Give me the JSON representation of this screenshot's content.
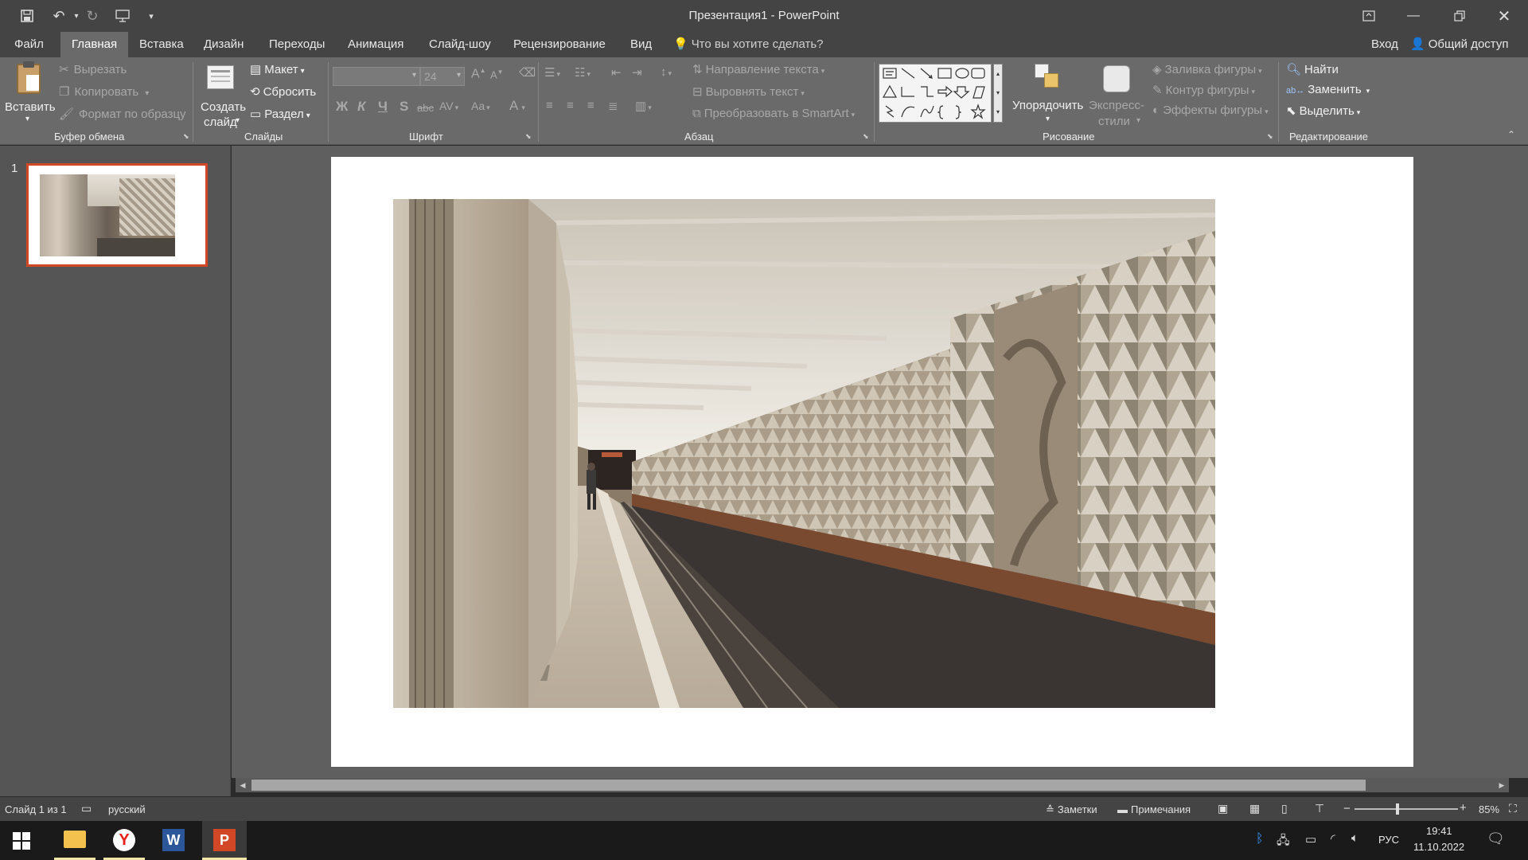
{
  "window": {
    "title": "Презентация1 - PowerPoint"
  },
  "tabs": {
    "file": "Файл",
    "home": "Главная",
    "insert": "Вставка",
    "design": "Дизайн",
    "transitions": "Переходы",
    "animations": "Анимация",
    "slideshow": "Слайд-шоу",
    "review": "Рецензирование",
    "view": "Вид",
    "tell_me": "Что вы хотите сделать?",
    "signin": "Вход",
    "share": "Общий доступ"
  },
  "ribbon": {
    "clipboard": {
      "paste": "Вставить",
      "cut": "Вырезать",
      "copy": "Копировать",
      "format_painter": "Формат по образцу",
      "label": "Буфер обмена"
    },
    "slides": {
      "new_slide_1": "Создать",
      "new_slide_2": "слайд",
      "layout": "Макет",
      "reset": "Сбросить",
      "section": "Раздел",
      "label": "Слайды"
    },
    "font": {
      "size": "24",
      "bold": "Ж",
      "italic": "К",
      "underline": "Ч",
      "shadow": "S",
      "strike": "abc",
      "spacing": "AV",
      "case": "Aa",
      "color": "A",
      "grow": "A",
      "shrink": "A",
      "label": "Шрифт"
    },
    "paragraph": {
      "text_direction": "Направление текста",
      "align_text": "Выровнять текст",
      "smartart": "Преобразовать в SmartArt",
      "label": "Абзац"
    },
    "drawing": {
      "arrange": "Упорядочить",
      "quick_styles_1": "Экспресс-",
      "quick_styles_2": "стили",
      "shape_fill": "Заливка фигуры",
      "shape_outline": "Контур фигуры",
      "shape_effects": "Эффекты фигуры",
      "label": "Рисование"
    },
    "editing": {
      "find": "Найти",
      "replace": "Заменить",
      "select": "Выделить",
      "label": "Редактирование"
    }
  },
  "slides_panel": {
    "number": "1"
  },
  "statusbar": {
    "slide_info": "Слайд 1 из 1",
    "language": "русский",
    "notes": "Заметки",
    "comments": "Примечания",
    "zoom": "85%"
  },
  "taskbar": {
    "lang": "РУС",
    "time": "19:41",
    "date": "11.10.2022"
  },
  "colors": {
    "accent": "#d24726",
    "ribbon": "#6a6a6a",
    "titlebar": "#444444"
  }
}
